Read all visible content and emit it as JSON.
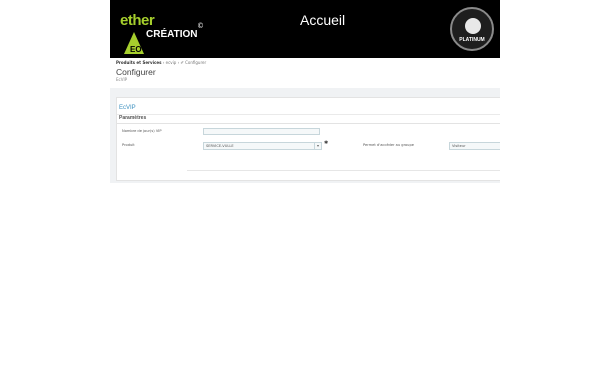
{
  "banner": {
    "logo_ether": "ether",
    "logo_creation": "CRÉATION",
    "logo_eo": "EO",
    "logo_copyright": "©",
    "title": "Accueil",
    "badge_text": "PLATINUM"
  },
  "breadcrumb": {
    "part1": "Produits et Services",
    "sep1": " › ",
    "part2": "ecvip",
    "sep2": " › ",
    "part3": "✐ Configurer"
  },
  "page": {
    "title": "Configurer",
    "subtitle": "EcVIP"
  },
  "panel": {
    "title": "EcVIP",
    "section": "Paramètres",
    "fields": {
      "days_label": "Nombre de jour(s) VIP",
      "days_value": "",
      "product_label": "Produit",
      "product_value": "SERVICE-VULLE",
      "group_label": "Permet d'accéder au groupe",
      "group_value": "Visiteur"
    }
  }
}
